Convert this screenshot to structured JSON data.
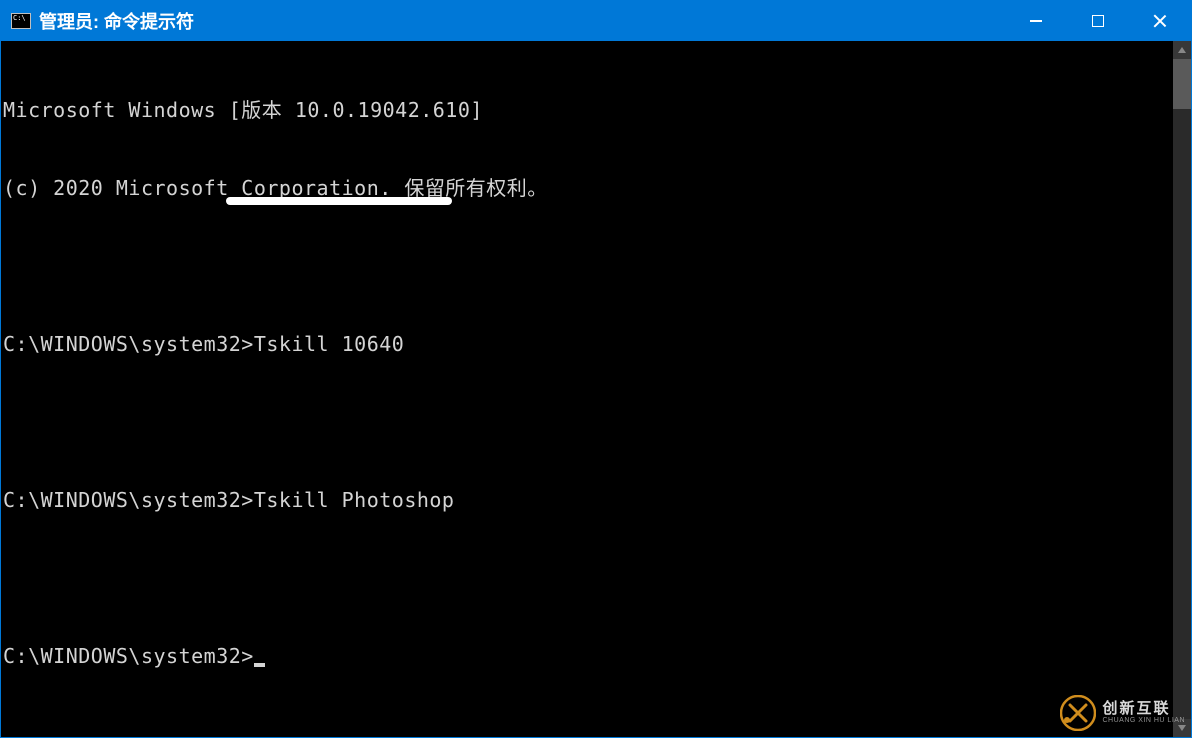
{
  "window": {
    "title": "管理员: 命令提示符"
  },
  "terminal": {
    "lines": [
      "Microsoft Windows [版本 10.0.19042.610]",
      "(c) 2020 Microsoft Corporation. 保留所有权利。",
      "",
      "C:\\WINDOWS\\system32>Tskill 10640",
      "",
      "C:\\WINDOWS\\system32>Tskill Photoshop",
      "",
      "C:\\WINDOWS\\system32>"
    ]
  },
  "watermark": {
    "cn": "创新互联",
    "en": "CHUANG XIN HU LIAN"
  }
}
